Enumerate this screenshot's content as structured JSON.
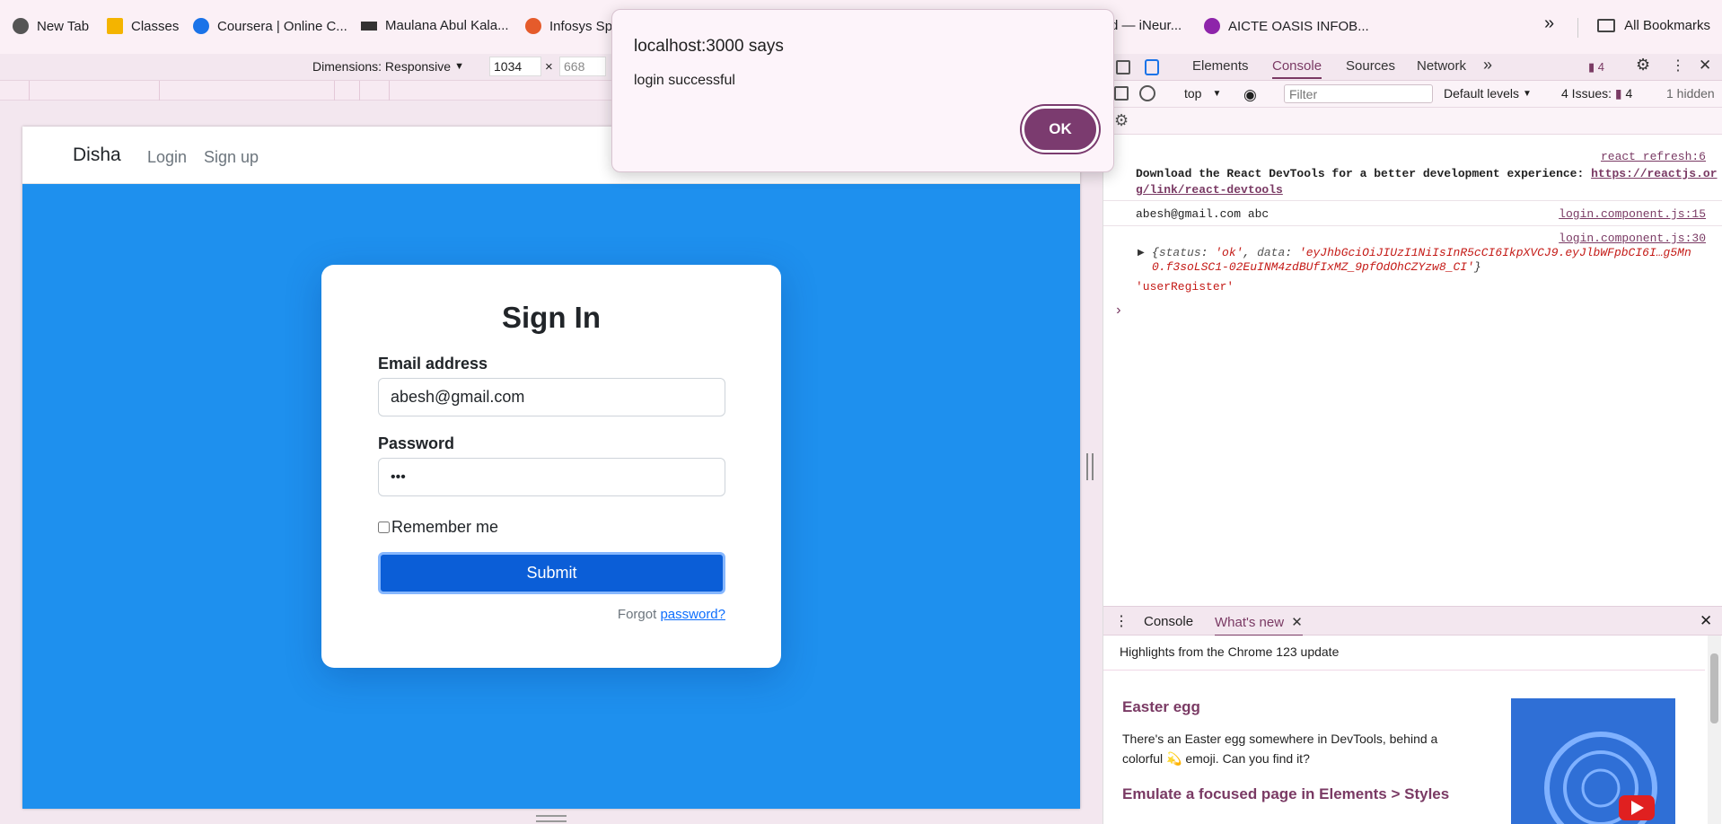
{
  "bookmarks": [
    {
      "label": "New Tab",
      "color": "#444444"
    },
    {
      "label": "Classes",
      "color": "#f4b400"
    },
    {
      "label": "Coursera | Online C...",
      "color": "#1a73e8"
    },
    {
      "label": "Maulana Abul Kala...",
      "color": "#333333"
    },
    {
      "label": "Infosys Sp",
      "color": "#e55b2b"
    },
    {
      "label": "d — iNeur...",
      "color": "#999999"
    },
    {
      "label": "AICTE OASIS INFOB...",
      "color": "#8e24aa"
    }
  ],
  "bookmarks_more": "»",
  "all_bookmarks": "All Bookmarks",
  "device_toolbar": {
    "dimensions_label": "Dimensions: Responsive",
    "width": "1034",
    "times": "×",
    "height": "668"
  },
  "alert": {
    "title": "localhost:3000 says",
    "message": "login successful",
    "ok_label": "OK"
  },
  "app": {
    "brand": "Disha",
    "nav": [
      "Login",
      "Sign up"
    ],
    "form": {
      "title": "Sign In",
      "email_label": "Email address",
      "email_value": "abesh@gmail.com",
      "password_label": "Password",
      "password_value": "•••",
      "remember_label": "Remember me",
      "submit_label": "Submit",
      "forgot_prefix": "Forgot",
      "forgot_link": "password?"
    }
  },
  "devtools": {
    "tabs": [
      "Elements",
      "Console",
      "Sources",
      "Network"
    ],
    "active_tab": "Console",
    "issues_badge": "4",
    "context": "top",
    "filter_placeholder": "Filter",
    "levels": "Default levels",
    "issues_label": "4 Issues:",
    "issues_count": "4",
    "hidden": "1 hidden",
    "console": [
      {
        "source": "react_refresh:6",
        "text": "Download the React DevTools for a better development experience: ",
        "link": "https://reactjs.org/link/react-devtools"
      },
      {
        "source": "login.component.js:15",
        "text": "abesh@gmail.com abc"
      },
      {
        "source": "login.component.js:30",
        "object_prefix": "{",
        "status_key": "status",
        "status_val": "'ok'",
        "data_key": "data",
        "data_val": "'eyJhbGciOiJIUzI1NiIsInR5cCI6IkpXVCJ9.eyJlbWFpbCI6I…g5Mn0.f3soLSC1-02EuINM4zdBUfIxMZ_9pfOdOhCZYzw8_CI'",
        "object_suffix": "}",
        "extra": "'userRegister'"
      }
    ],
    "prompt": "›",
    "drawer_tabs": [
      "Console",
      "What's new"
    ],
    "drawer_active": "What's new",
    "whatsnew": {
      "highlights": "Highlights from the Chrome 123 update",
      "h1": "Easter egg",
      "p1": "There's an Easter egg somewhere in DevTools, behind a colorful 💫 emoji. Can you find it?",
      "h2": "Emulate a focused page in Elements > Styles"
    }
  }
}
